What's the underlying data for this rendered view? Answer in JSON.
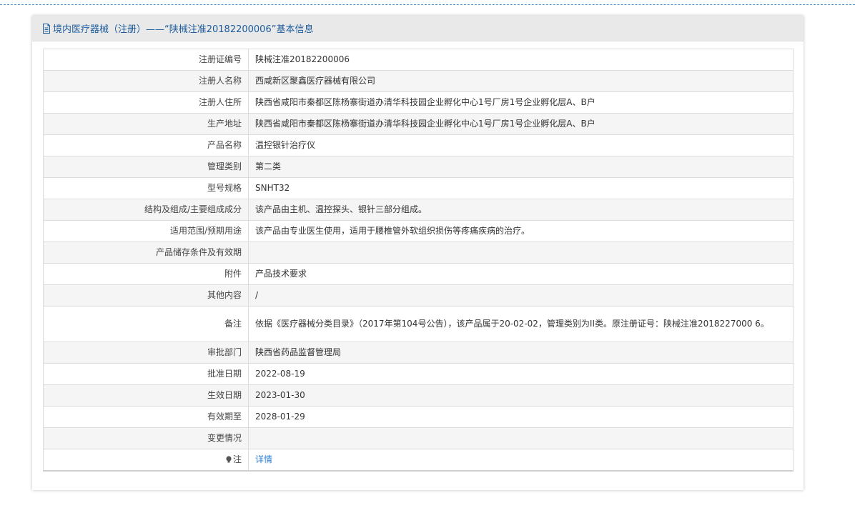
{
  "header": {
    "title": "境内医疗器械（注册）——“陕械注准20182200006”基本信息",
    "icon": "document-icon"
  },
  "rows": [
    {
      "label": "注册证编号",
      "value": "陕械注准20182200006"
    },
    {
      "label": "注册人名称",
      "value": "西咸新区聚鑫医疗器械有限公司"
    },
    {
      "label": "注册人住所",
      "value": "陕西省咸阳市秦都区陈杨寨街道办清华科技园企业孵化中心1号厂房1号企业孵化层A、B户"
    },
    {
      "label": "生产地址",
      "value": "陕西省咸阳市秦都区陈杨寨街道办清华科技园企业孵化中心1号厂房1号企业孵化层A、B户"
    },
    {
      "label": "产品名称",
      "value": "温控银针治疗仪"
    },
    {
      "label": "管理类别",
      "value": "第二类"
    },
    {
      "label": "型号规格",
      "value": "SNHT32"
    },
    {
      "label": "结构及组成/主要组成成分",
      "value": "该产品由主机、温控探头、银针三部分组成。"
    },
    {
      "label": "适用范围/预期用途",
      "value": "该产品由专业医生使用，适用于腰椎管外软组织损伤等疼痛疾病的治疗。"
    },
    {
      "label": "产品储存条件及有效期",
      "value": ""
    },
    {
      "label": "附件",
      "value": "产品技术要求"
    },
    {
      "label": "其他内容",
      "value": "/"
    },
    {
      "label": "备注",
      "value": "依据《医疗器械分类目录》（2017年第104号公告），该产品属于20-02-02，管理类别为II类。原注册证号：陕械注准2018227000 6。"
    },
    {
      "label": "审批部门",
      "value": "陕西省药品监督管理局"
    },
    {
      "label": "批准日期",
      "value": "2022-08-19"
    },
    {
      "label": "生效日期",
      "value": "2023-01-30"
    },
    {
      "label": "有效期至",
      "value": "2028-01-29"
    },
    {
      "label": "变更情况",
      "value": ""
    }
  ],
  "note": {
    "label": "注",
    "icon": "bulb-icon",
    "link_text": "详情"
  }
}
